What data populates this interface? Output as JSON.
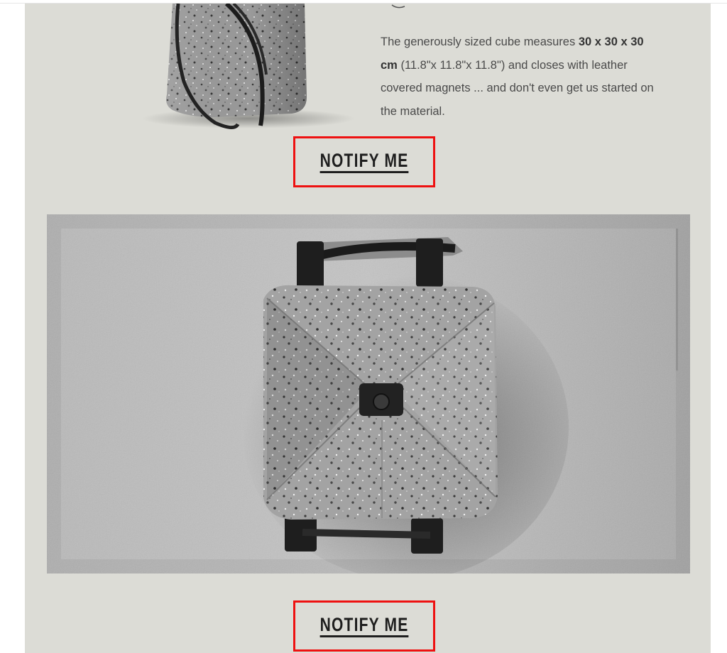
{
  "description": {
    "text_1": "The generously sized cube measures ",
    "bold_1": "30 x 30 x 30 cm",
    "text_2": " (11.8\"x 11.8\"x 11.8\") and closes with leather covered magnets ... and don't even get us started on the material."
  },
  "notify_buttons": [
    {
      "label": "NOTIFY ME"
    },
    {
      "label": "NOTIFY ME"
    }
  ],
  "images": {
    "tote": {
      "icon": "tote-bag-photo"
    },
    "cube": {
      "icon": "felt-cube-bag-photo"
    }
  },
  "colors": {
    "email_background": "#dcdcd6",
    "highlight_border": "#ee1111",
    "button_text": "#1e1e1e",
    "body_text": "#4a4a4a"
  }
}
